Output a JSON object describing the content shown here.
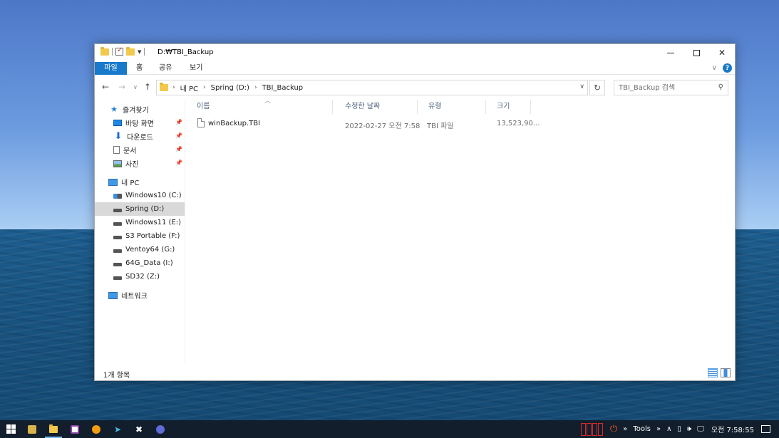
{
  "window": {
    "title": "D:₩TBI_Backup",
    "ribbon_tabs": [
      "파일",
      "홈",
      "공유",
      "보기"
    ]
  },
  "nav": {
    "breadcrumb": [
      "내 PC",
      "Spring (D:)",
      "TBI_Backup"
    ],
    "search_placeholder": "TBI_Backup 검색"
  },
  "sidebar": {
    "quick_access": "즐겨찾기",
    "quick_items": [
      {
        "label": "바탕 화면",
        "icon": "desktop-icon"
      },
      {
        "label": "다운로드",
        "icon": "download-icon"
      },
      {
        "label": "문서",
        "icon": "document-icon"
      },
      {
        "label": "사진",
        "icon": "pictures-icon"
      }
    ],
    "this_pc": "내 PC",
    "drives": [
      {
        "label": "Windows10 (C:)",
        "icon": "windows-drive-icon"
      },
      {
        "label": "Spring (D:)",
        "icon": "drive-icon",
        "selected": true
      },
      {
        "label": "Windows11 (E:)",
        "icon": "drive-icon"
      },
      {
        "label": "S3 Portable (F:)",
        "icon": "drive-icon"
      },
      {
        "label": "Ventoy64 (G:)",
        "icon": "drive-icon"
      },
      {
        "label": "64G_Data (I:)",
        "icon": "drive-icon"
      },
      {
        "label": "SD32 (Z:)",
        "icon": "drive-icon"
      }
    ],
    "network": "네트워크"
  },
  "columns": {
    "name": "이름",
    "date": "수정한 날짜",
    "type": "유형",
    "size": "크기"
  },
  "files": [
    {
      "name": "winBackup.TBI",
      "date": "2022-02-27 오전 7:58",
      "type": "TBI 파일",
      "size": "13,523,90..."
    }
  ],
  "status": {
    "count": "1개 항목"
  },
  "taskbar": {
    "tools_label": "Tools",
    "clock": "오전 7:58:55"
  },
  "colors": {
    "accent": "#1979ca",
    "taskbar": "#121e2c",
    "selected_nav": "#d9d9d9"
  }
}
